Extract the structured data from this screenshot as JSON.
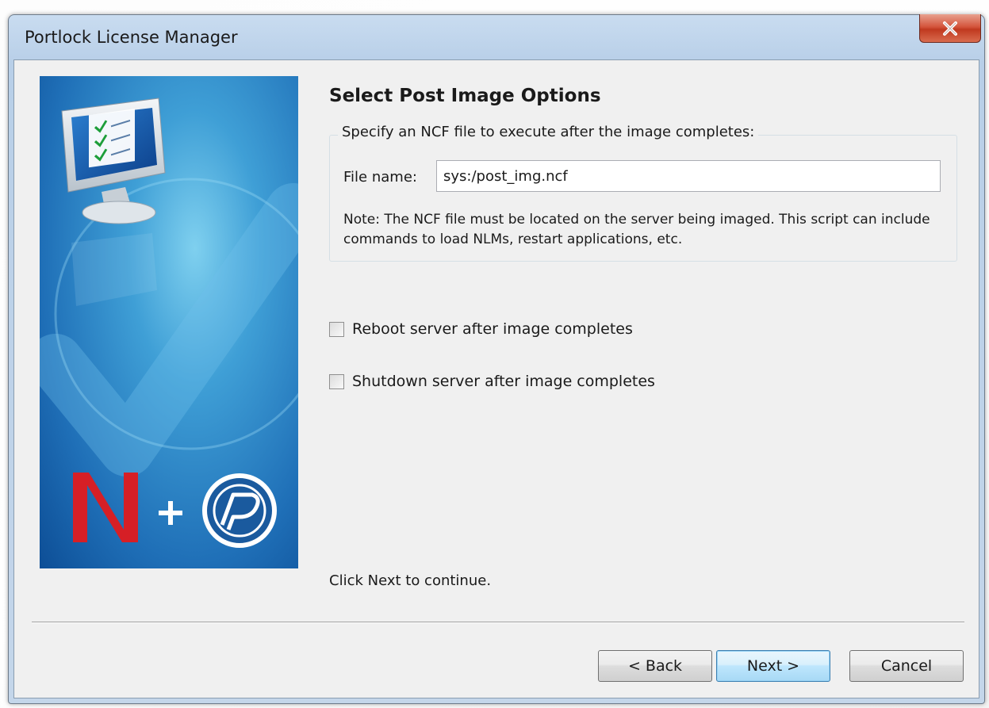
{
  "window": {
    "title": "Portlock License Manager"
  },
  "page": {
    "heading": "Select Post Image Options",
    "group_legend": "Specify an NCF file to execute after the image completes:",
    "file_label": "File name:",
    "file_value": "sys:/post_img.ncf",
    "note": "Note: The NCF file must be located on the server being imaged. This script can include commands to load NLMs, restart applications, etc.",
    "reboot_label": "Reboot server after image completes",
    "reboot_checked": false,
    "shutdown_label": "Shutdown server after image completes",
    "shutdown_checked": false,
    "hint": "Click Next to continue."
  },
  "buttons": {
    "back": "< Back",
    "next": "Next >",
    "cancel": "Cancel"
  },
  "colors": {
    "close_button": "#c0391f",
    "banner_blue": "#1f6fb7",
    "novell_red": "#d61f26"
  },
  "icons": [
    "close-icon",
    "monitor-checklist-icon",
    "novell-n-logo",
    "portlock-logo"
  ]
}
